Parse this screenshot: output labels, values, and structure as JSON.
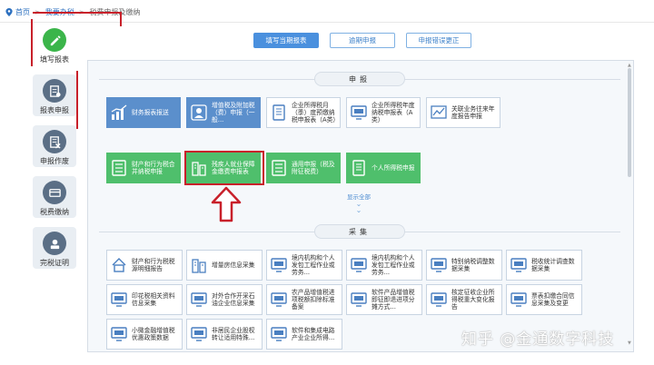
{
  "breadcrumb": {
    "home": "首页",
    "level1": "我要办税",
    "level2": "税费申报及缴纳"
  },
  "nav": [
    {
      "label": "填写报表",
      "icon": "pencil-icon"
    },
    {
      "label": "报表申报",
      "icon": "form-icon"
    },
    {
      "label": "申报作废",
      "icon": "void-icon"
    },
    {
      "label": "税费缴纳",
      "icon": "payment-icon"
    },
    {
      "label": "完税证明",
      "icon": "certificate-icon"
    }
  ],
  "tabs": [
    {
      "label": "填写当期报表",
      "active": true
    },
    {
      "label": "逾期申报",
      "active": false
    },
    {
      "label": "申报错误更正",
      "active": false
    }
  ],
  "sections": {
    "declare": "申报",
    "collect": "采集"
  },
  "declare_row1": [
    {
      "label": "财务报表报送",
      "style": "blue",
      "icon": "chart-icon"
    },
    {
      "label": "增值税及附加税（费）申报（一般...",
      "style": "blue",
      "icon": "person-icon"
    },
    {
      "label": "企业所得税月（季）度预缴纳税申报表（A类）",
      "style": "white",
      "icon": "doc-icon"
    },
    {
      "label": "企业所得税年度纳税申报表（A类）",
      "style": "white",
      "icon": "monitor-icon"
    },
    {
      "label": "关联业务往来年度报告申报",
      "style": "white",
      "icon": "trend-icon"
    }
  ],
  "declare_row2": [
    {
      "label": "财产和行为税合并纳税申报",
      "style": "green",
      "icon": "list-icon"
    },
    {
      "label": "残疾人就业保障金缴费申报表",
      "style": "green",
      "icon": "building-icon"
    },
    {
      "label": "通用申报（税及附征税费）",
      "style": "green",
      "icon": "list-icon"
    },
    {
      "label": "个人所得税申报",
      "style": "green",
      "icon": "doc-icon"
    }
  ],
  "show_all": "显示全部",
  "collect_rows": [
    [
      {
        "label": "财产和行为税税源明细报告",
        "icon": "house-icon"
      },
      {
        "label": "增量房信息采集",
        "icon": "building-icon"
      },
      {
        "label": "境内机构和个人发包工程作业或劳务...",
        "icon": "monitor-icon"
      },
      {
        "label": "境内机构和个人发包工程作业或劳务...",
        "icon": "monitor-icon"
      },
      {
        "label": "特别纳税调整数据采集",
        "icon": "monitor-icon"
      },
      {
        "label": "税收统计调查数据采集",
        "icon": "monitor-icon"
      }
    ],
    [
      {
        "label": "印花税相关资料信息采集",
        "icon": "monitor-icon"
      },
      {
        "label": "对外合作开采石油企业信息采集",
        "icon": "monitor-icon"
      },
      {
        "label": "农产品增值税进项税额扣除标准备案",
        "icon": "monitor-icon"
      },
      {
        "label": "软件产品增值税即征即退进项分摊方式...",
        "icon": "monitor-icon"
      },
      {
        "label": "核定征收企业所得税重大变化报告",
        "icon": "monitor-icon"
      },
      {
        "label": "票表扣缴合同信息采集及变更",
        "icon": "monitor-icon"
      }
    ],
    [
      {
        "label": "小微金融增值税优惠政策数据",
        "icon": "monitor-icon"
      },
      {
        "label": "非居民企业股权转让适用特殊...",
        "icon": "monitor-icon"
      },
      {
        "label": "软件和集成电路产业企业所得...",
        "icon": "monitor-icon"
      }
    ]
  ],
  "watermark": "知乎 @金通数字科技",
  "colors": {
    "accent_blue": "#4a90de",
    "green": "#4fbf6c",
    "highlight_red": "#c8202a",
    "nav_active": "#3bb54a"
  }
}
